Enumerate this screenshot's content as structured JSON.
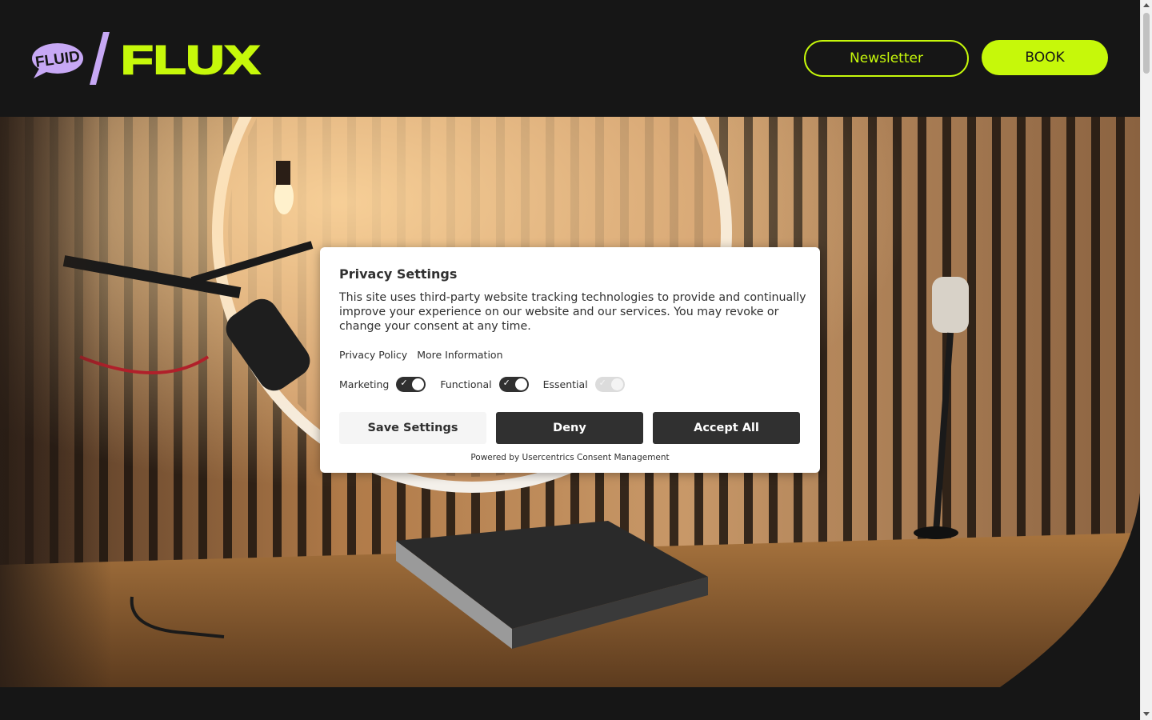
{
  "header": {
    "logo": {
      "badge_text": "FLUID",
      "brand_text": "FLUX"
    },
    "newsletter_label": "Newsletter",
    "book_label": "BOOK"
  },
  "hero": {
    "image_description": "podcast-studio-photo"
  },
  "consent": {
    "title": "Privacy Settings",
    "text": "This site uses third-party website tracking technologies to provide and continually improve your experience on our website and our services. You may revoke or change your consent at any time.",
    "links": {
      "privacy_policy": "Privacy Policy",
      "more_information": "More Information"
    },
    "toggles": [
      {
        "label": "Marketing",
        "checked": true,
        "disabled": false
      },
      {
        "label": "Functional",
        "checked": true,
        "disabled": false
      },
      {
        "label": "Essential",
        "checked": true,
        "disabled": true
      }
    ],
    "buttons": {
      "save": "Save Settings",
      "deny": "Deny",
      "accept": "Accept All"
    },
    "powered_by": "Powered by Usercentrics Consent Management"
  },
  "colors": {
    "background": "#161616",
    "accent": "#c6f80a",
    "logo_purple": "#c7a8f5",
    "dialog_dark": "#303030"
  }
}
